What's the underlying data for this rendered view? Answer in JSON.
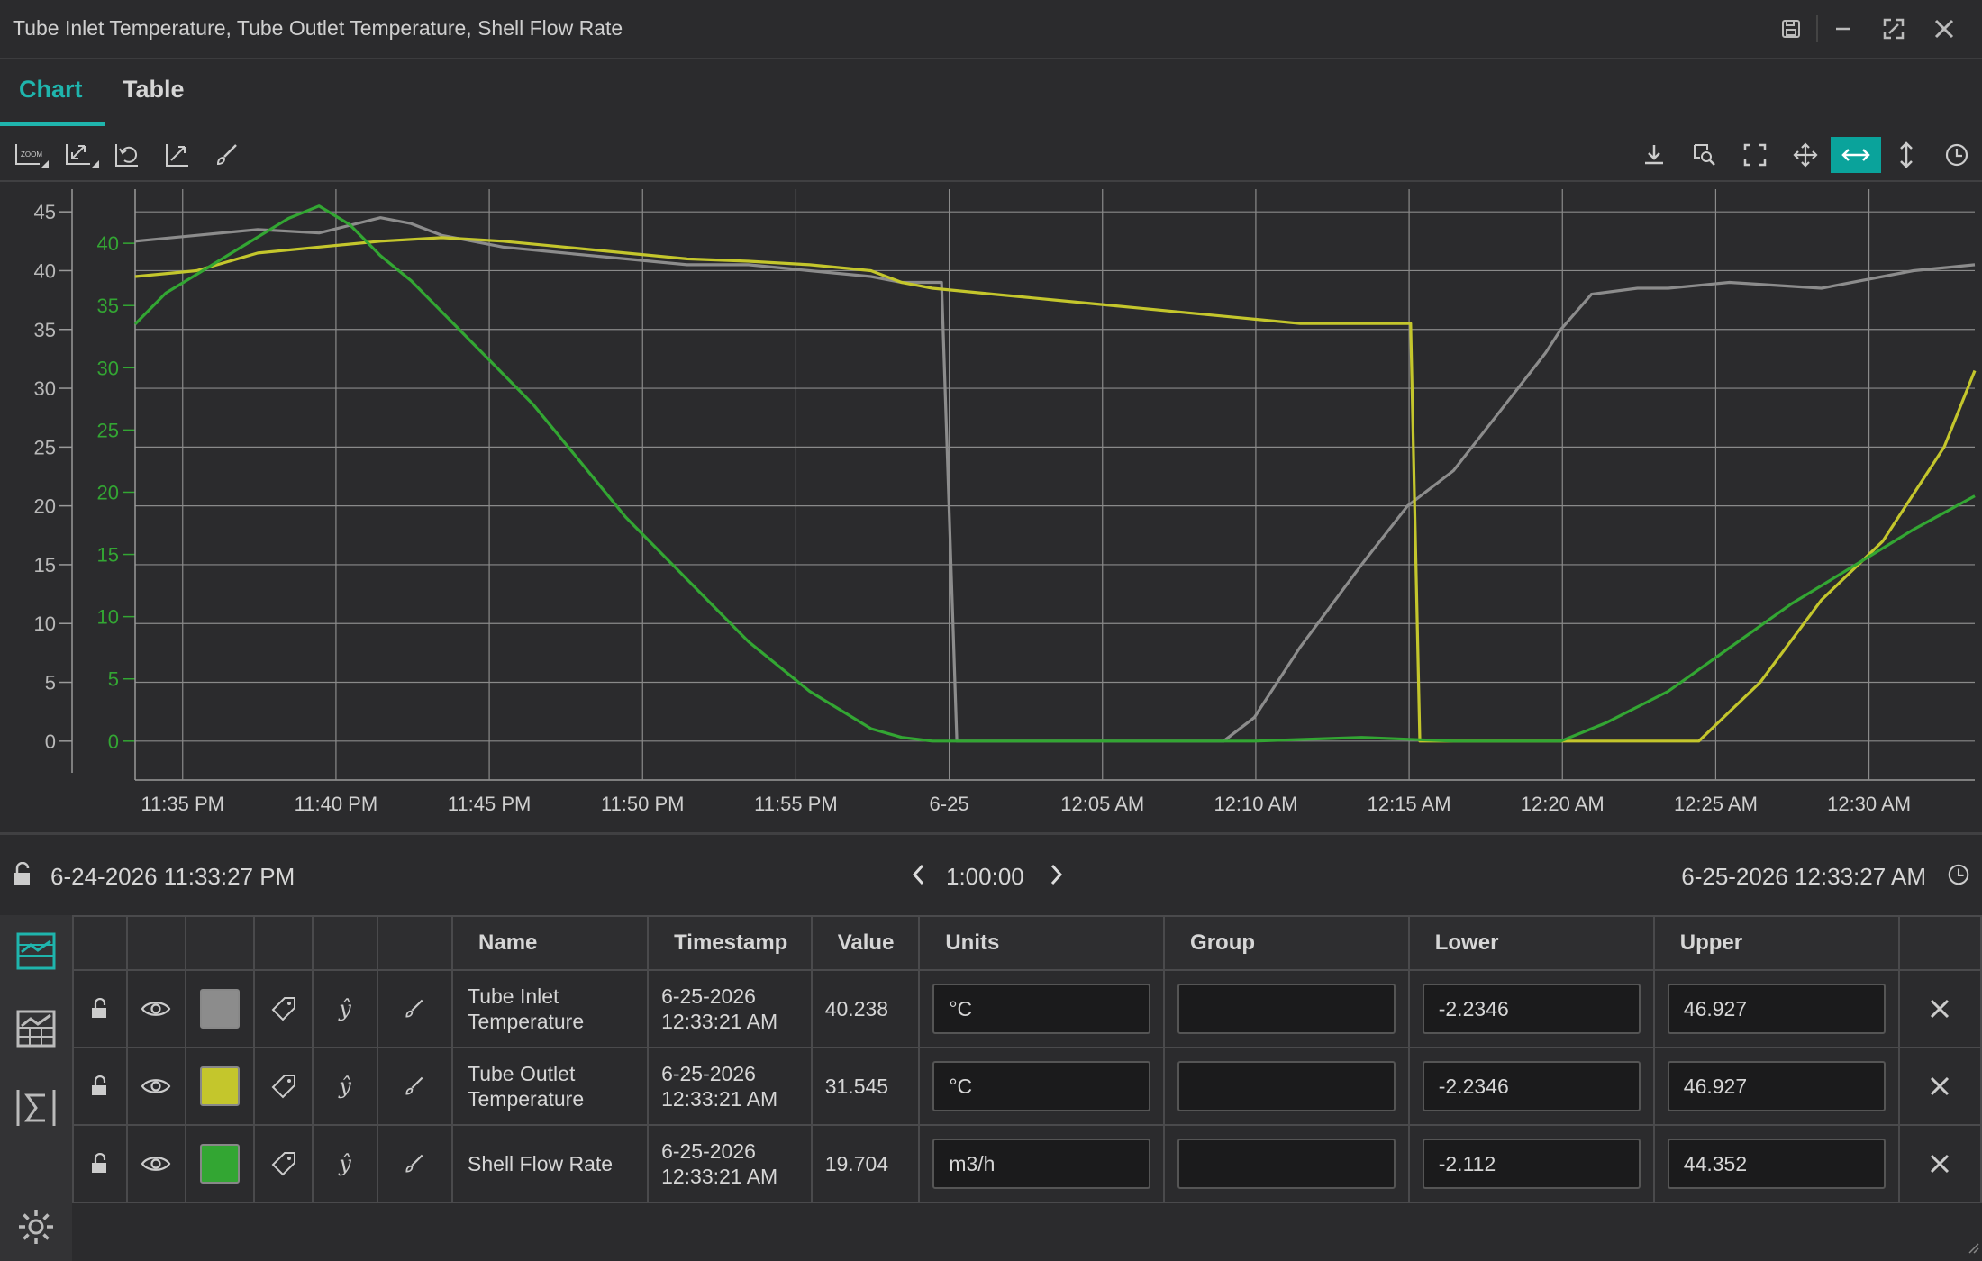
{
  "window": {
    "title": "Tube Inlet Temperature, Tube Outlet Temperature, Shell Flow Rate"
  },
  "tabs": [
    {
      "label": "Chart",
      "active": true
    },
    {
      "label": "Table",
      "active": false
    }
  ],
  "toolbar": {
    "left_icons": [
      "zoom-x-icon",
      "zoom-xy-icon",
      "undo-zoom-icon",
      "autoscale-icon",
      "brush-icon"
    ],
    "right_icons": [
      "download-icon",
      "zoom-select-icon",
      "fullscreen-icon",
      "pan-icon",
      "pan-horizontal-icon",
      "pan-vertical-icon",
      "history-icon"
    ],
    "active_icon": "pan-horizontal-icon"
  },
  "range": {
    "start": "6-24-2026 11:33:27 PM",
    "duration": "1:00:00",
    "end": "6-25-2026 12:33:27 AM"
  },
  "table": {
    "headers": [
      "Name",
      "Timestamp",
      "Value",
      "Units",
      "Group",
      "Lower",
      "Upper"
    ],
    "rows": [
      {
        "name": "Tube Inlet Temperature",
        "timestamp": "6-25-2026 12:33:21 AM",
        "value": "40.238",
        "units": "°C",
        "group": "",
        "lower": "-2.2346",
        "upper": "46.927",
        "color": "#8c8c8c"
      },
      {
        "name": "Tube Outlet Temperature",
        "timestamp": "6-25-2026 12:33:21 AM",
        "value": "31.545",
        "units": "°C",
        "group": "",
        "lower": "-2.2346",
        "upper": "46.927",
        "color": "#c4c62c"
      },
      {
        "name": "Shell Flow Rate",
        "timestamp": "6-25-2026 12:33:21 AM",
        "value": "19.704",
        "units": "m3/h",
        "group": "",
        "lower": "-2.112",
        "upper": "44.352",
        "color": "#33a633"
      }
    ]
  },
  "chart_data": {
    "type": "line",
    "x_tick_labels": [
      "11:35 PM",
      "11:40 PM",
      "11:45 PM",
      "11:50 PM",
      "11:55 PM",
      "6-25",
      "12:05 AM",
      "12:10 AM",
      "12:15 AM",
      "12:20 AM",
      "12:25 AM",
      "12:30 AM"
    ],
    "x_tick_minutes": [
      1.55,
      6.55,
      11.55,
      16.55,
      21.55,
      26.55,
      31.55,
      36.55,
      41.55,
      46.55,
      51.55,
      56.55
    ],
    "xlim_minutes": [
      0,
      60
    ],
    "y_axis_temp": {
      "ticks": [
        0,
        5,
        10,
        15,
        20,
        25,
        30,
        35,
        40,
        45
      ],
      "ylim": [
        -2.2346,
        46.927
      ],
      "color": "#b8b8b8"
    },
    "y_axis_flow": {
      "ticks": [
        0,
        5,
        10,
        15,
        20,
        25,
        30,
        35,
        40
      ],
      "ylim": [
        -2.112,
        44.352
      ],
      "color": "#33a633"
    },
    "grid": true,
    "series": [
      {
        "name": "Tube Inlet Temperature",
        "color": "#8c8c8c",
        "axis": "temp",
        "x": [
          0,
          2,
          4,
          6,
          8,
          9,
          10,
          12,
          14,
          16,
          18,
          20,
          22,
          24,
          25,
          26,
          26.3,
          26.8,
          35.5,
          36.5,
          38,
          40,
          41.5,
          43,
          44.5,
          46,
          46.5,
          47.5,
          49,
          50,
          52,
          55,
          58,
          60
        ],
        "y": [
          42.5,
          43.0,
          43.5,
          43.2,
          44.5,
          44.0,
          43.0,
          42.0,
          41.5,
          41.0,
          40.5,
          40.5,
          40.0,
          39.5,
          39.0,
          39.0,
          39.0,
          0,
          0,
          2.0,
          8.0,
          15.0,
          20.0,
          23.0,
          28.0,
          33.0,
          35.0,
          38.0,
          38.5,
          38.5,
          39.0,
          38.5,
          40.0,
          40.5
        ]
      },
      {
        "name": "Tube Outlet Temperature",
        "color": "#c4c62c",
        "axis": "temp",
        "x": [
          0,
          2,
          4,
          6,
          8,
          10,
          12,
          14,
          16,
          18,
          20,
          22,
          24,
          25,
          26,
          28,
          30,
          32,
          34,
          36,
          38,
          40,
          41.6,
          41.9,
          51,
          53,
          55,
          57,
          59,
          60
        ],
        "y": [
          39.5,
          40.0,
          41.5,
          42.0,
          42.5,
          42.8,
          42.5,
          42.0,
          41.5,
          41.0,
          40.8,
          40.5,
          40.0,
          39.0,
          38.5,
          38.0,
          37.5,
          37.0,
          36.5,
          36.0,
          35.5,
          35.5,
          35.5,
          0,
          0,
          5.0,
          12.0,
          17.0,
          25.0,
          31.5
        ]
      },
      {
        "name": "Shell Flow Rate",
        "color": "#33a633",
        "axis": "flow",
        "x": [
          0,
          1,
          2,
          3,
          4,
          5,
          6,
          7,
          8,
          9,
          10,
          11,
          12,
          13,
          14,
          15,
          16,
          17,
          18,
          19,
          20,
          21,
          22,
          23,
          24,
          25,
          26,
          36.5,
          40,
          43,
          46.5,
          48,
          50,
          52,
          54,
          56,
          58,
          60
        ],
        "y": [
          33.5,
          36.0,
          37.5,
          39.0,
          40.5,
          42.0,
          43.0,
          41.5,
          39.0,
          37.0,
          34.5,
          32.0,
          29.5,
          27.0,
          24.0,
          21.0,
          18.0,
          15.5,
          13.0,
          10.5,
          8.0,
          6.0,
          4.0,
          2.5,
          1.0,
          0.3,
          0,
          0,
          0.3,
          0,
          0,
          1.5,
          4.0,
          7.5,
          11.0,
          14.0,
          17.0,
          19.7
        ]
      }
    ]
  }
}
